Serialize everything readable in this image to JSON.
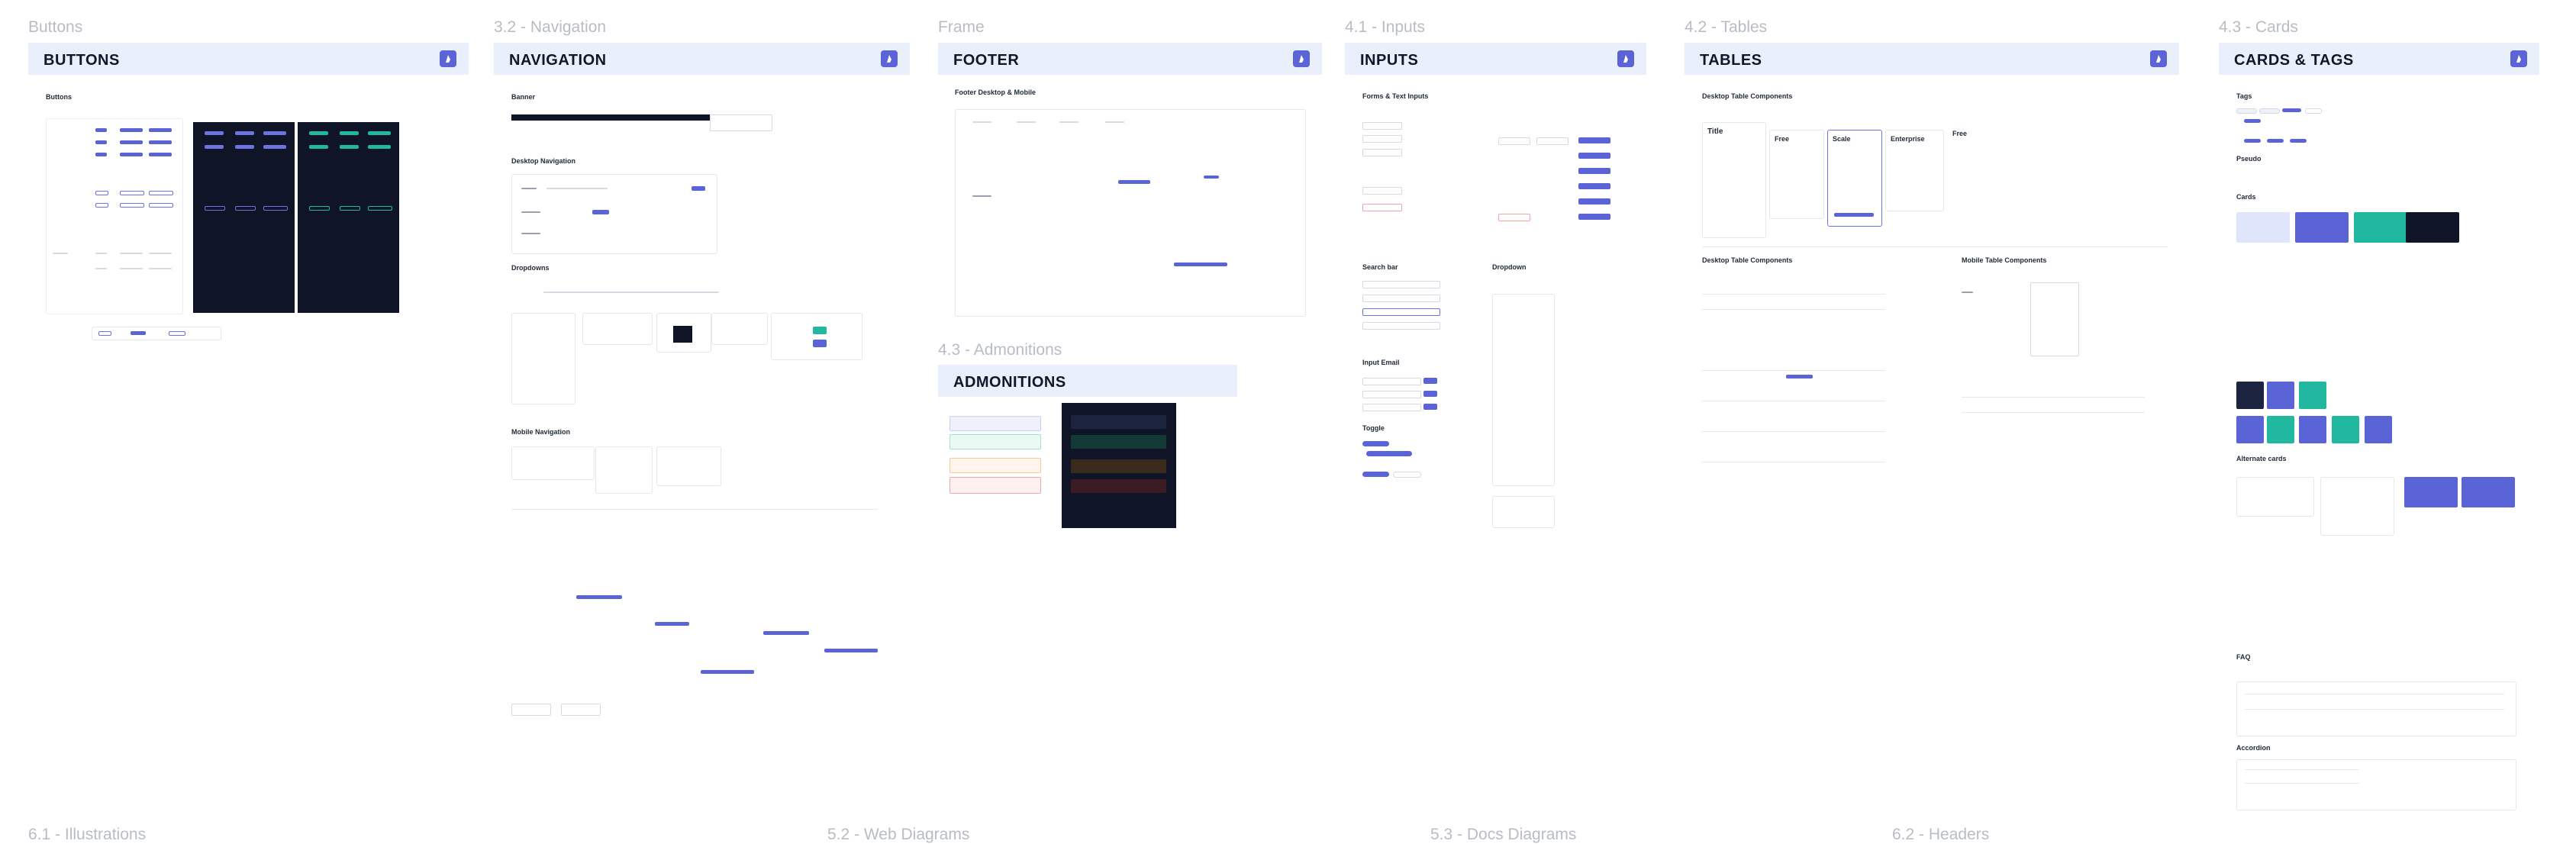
{
  "frames": {
    "buttons": {
      "label": "Buttons",
      "header": "BUTTONS",
      "section": "Buttons"
    },
    "navigation": {
      "label": "3.2 - Navigation",
      "header": "NAVIGATION",
      "sections": {
        "banner": "Banner",
        "desktop": "Desktop Navigation",
        "dropdowns": "Dropdowns",
        "mobile": "Mobile Navigation"
      }
    },
    "footer": {
      "label": "Frame",
      "header": "FOOTER",
      "section": "Footer Desktop & Mobile"
    },
    "admonitions": {
      "label": "4.3 - Admonitions",
      "header": "ADMONITIONS"
    },
    "inputs": {
      "label": "4.1 - Inputs",
      "header": "INPUTS",
      "sections": {
        "forms": "Forms & Text Inputs",
        "search": "Search bar",
        "email": "Input Email",
        "toggle": "Toggle",
        "dropdown": "Dropdown"
      }
    },
    "tables": {
      "label": "4.2 - Tables",
      "header": "TABLES",
      "sections": {
        "desktop_pricing": "Desktop Table Components",
        "desktop_table": "Desktop Table Components",
        "mobile_table": "Mobile Table Components"
      },
      "pricing": {
        "title": "Title",
        "free": "Free",
        "scale": "Scale",
        "enterprise": "Enterprise",
        "free2": "Free"
      }
    },
    "cards": {
      "label": "4.3 - Cards",
      "header": "CARDS & TAGS",
      "sections": {
        "tags": "Tags",
        "pseudo": "Pseudo",
        "cards": "Cards",
        "alternate": "Alternate cards",
        "faq": "FAQ",
        "accordion": "Accordion"
      }
    }
  },
  "bottom_labels": [
    "6.1 - Illustrations",
    "5.2 - Web Diagrams",
    "5.3 - Docs Diagrams",
    "6.2 - Headers"
  ],
  "colors": {
    "accent": "#5a64d6",
    "header_bg": "#eaf0fb",
    "label": "#b8bcc4",
    "dark": "#0f1526",
    "teal": "#22b8a0"
  }
}
